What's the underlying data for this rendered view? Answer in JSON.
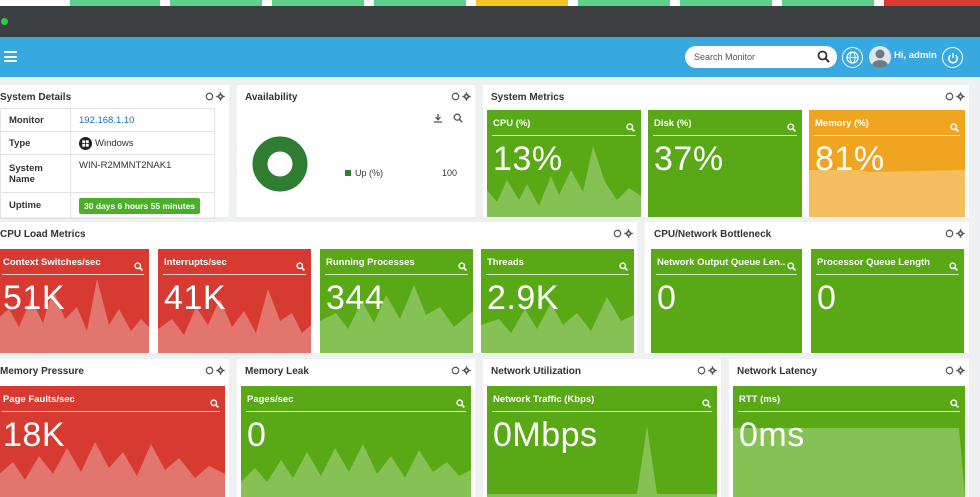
{
  "colors": {
    "navbar": "#38a9e0",
    "green": "#58a915",
    "red": "#d73a31",
    "orange": "#f0a520",
    "donut": "#2e7d32"
  },
  "search": {
    "placeholder": "Search Monitor"
  },
  "user": {
    "greeting": "Hi, admin"
  },
  "icons": {
    "menu": "hamburger-icon",
    "search": "search-icon",
    "globe": "globe-icon",
    "power": "power-icon",
    "settings": "gear-icon",
    "refresh": "refresh-icon",
    "download": "download-icon"
  },
  "system_details": {
    "title": "System Details",
    "rows": [
      {
        "key": "Monitor",
        "value": "192.168.1.10"
      },
      {
        "key": "Type",
        "value": "Windows"
      },
      {
        "key": "System Name",
        "value": "WIN-R2MMNT2NAK1"
      },
      {
        "key": "Uptime",
        "value": "30 days 6 hours 55 minutes"
      }
    ]
  },
  "availability": {
    "title": "Availability",
    "legend_label": "Up (%)",
    "legend_value": "100",
    "up_percent": 100
  },
  "system_metrics": {
    "title": "System Metrics",
    "tiles": [
      {
        "label": "CPU (%)",
        "value": "13%",
        "color": "green"
      },
      {
        "label": "Disk (%)",
        "value": "37%",
        "color": "green"
      },
      {
        "label": "Memory (%)",
        "value": "81%",
        "color": "orange"
      }
    ]
  },
  "cpu_load": {
    "title": "CPU Load Metrics",
    "tiles": [
      {
        "label": "Context Switches/sec",
        "value": "51K",
        "color": "red"
      },
      {
        "label": "Interrupts/sec",
        "value": "41K",
        "color": "red"
      },
      {
        "label": "Running Processes",
        "value": "344",
        "color": "green"
      },
      {
        "label": "Threads",
        "value": "2.9K",
        "color": "green"
      }
    ]
  },
  "bottleneck": {
    "title": "CPU/Network Bottleneck",
    "tiles": [
      {
        "label": "Network Output Queue Len...",
        "value": "0",
        "color": "green"
      },
      {
        "label": "Processor Queue Length",
        "value": "0",
        "color": "green"
      }
    ]
  },
  "memory_pressure": {
    "title": "Memory Pressure",
    "tiles": [
      {
        "label": "Page Faults/sec",
        "value": "18K",
        "color": "red"
      }
    ]
  },
  "memory_leak": {
    "title": "Memory Leak",
    "tiles": [
      {
        "label": "Pages/sec",
        "value": "0",
        "color": "green"
      }
    ]
  },
  "network_util": {
    "title": "Network Utilization",
    "tiles": [
      {
        "label": "Network Traffic (Kbps)",
        "value": "0Mbps",
        "color": "green"
      }
    ]
  },
  "network_latency": {
    "title": "Network Latency",
    "tiles": [
      {
        "label": "RTT (ms)",
        "value": "0ms",
        "color": "green"
      }
    ]
  }
}
